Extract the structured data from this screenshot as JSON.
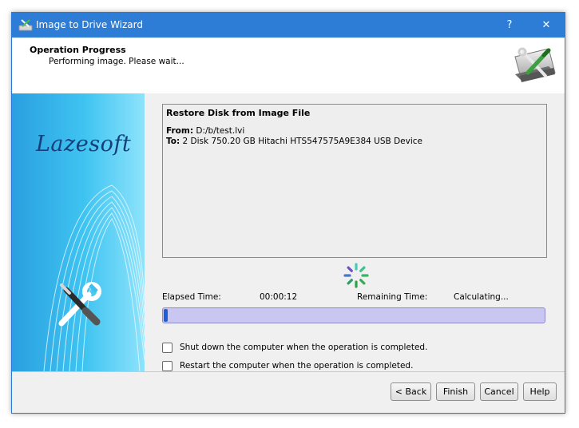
{
  "window": {
    "title": "Image to Drive Wizard",
    "help_label": "?",
    "close_label": "✕"
  },
  "header": {
    "title": "Operation Progress",
    "subtitle": "Performing image. Please wait..."
  },
  "sidebar": {
    "brand": "Lazesoft"
  },
  "log": {
    "title": "Restore Disk from Image File",
    "from_label": "From:",
    "from_value": "D:/b/test.lvi",
    "to_label": "To:",
    "to_value": "2 Disk 750.20 GB Hitachi HTS547575A9E384 USB Device"
  },
  "status": {
    "elapsed_label": "Elapsed Time:",
    "elapsed_value": "00:00:12",
    "remaining_label": "Remaining Time:",
    "remaining_value": "Calculating..."
  },
  "progress": {
    "percent": 1
  },
  "options": {
    "shutdown_label": "Shut down the computer when the operation is completed.",
    "shutdown_checked": false,
    "restart_label": "Restart the computer when the operation is completed.",
    "restart_checked": false
  },
  "buttons": {
    "back": "< Back",
    "finish": "Finish",
    "cancel": "Cancel",
    "help": "Help"
  },
  "colors": {
    "titlebar": "#2d7dd6",
    "progress_track": "#c9c6f2",
    "progress_fill": "#1c5fd8",
    "brand_text": "#153f7a",
    "sidebar_blue": "#27b8ec"
  },
  "icons": {
    "app": "drive-tools-icon",
    "header": "disk-wrench-screwdriver-icon",
    "sidebar": "wrench-screwdriver-icon",
    "spinner": "loading-spinner-icon"
  }
}
